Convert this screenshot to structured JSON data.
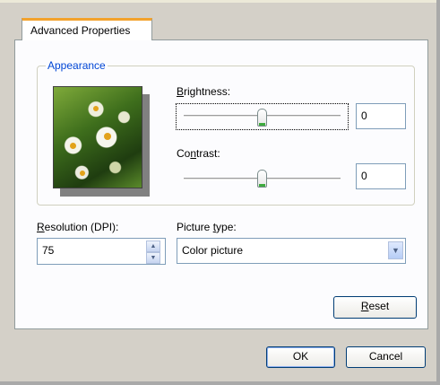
{
  "dialog": {
    "tab_label": "Advanced Properties",
    "group_label": "Appearance"
  },
  "brightness": {
    "label_prefix": "",
    "accel": "B",
    "label_rest": "rightness:",
    "value": "0",
    "level": 0.5
  },
  "contrast": {
    "label_prefix": "Co",
    "accel": "n",
    "label_rest": "trast:",
    "value": "0",
    "level": 0.5
  },
  "resolution": {
    "label_prefix": "",
    "accel": "R",
    "label_rest": "esolution (DPI):",
    "value": "75"
  },
  "picture_type": {
    "label_prefix": "Picture ",
    "accel": "t",
    "label_rest": "ype:",
    "selected": "Color picture"
  },
  "buttons": {
    "reset_accel": "R",
    "reset_rest": "eset",
    "ok": "OK",
    "cancel": "Cancel"
  },
  "icons": {
    "spin_up": "▲",
    "spin_down": "▼",
    "dropdown": "▼"
  }
}
